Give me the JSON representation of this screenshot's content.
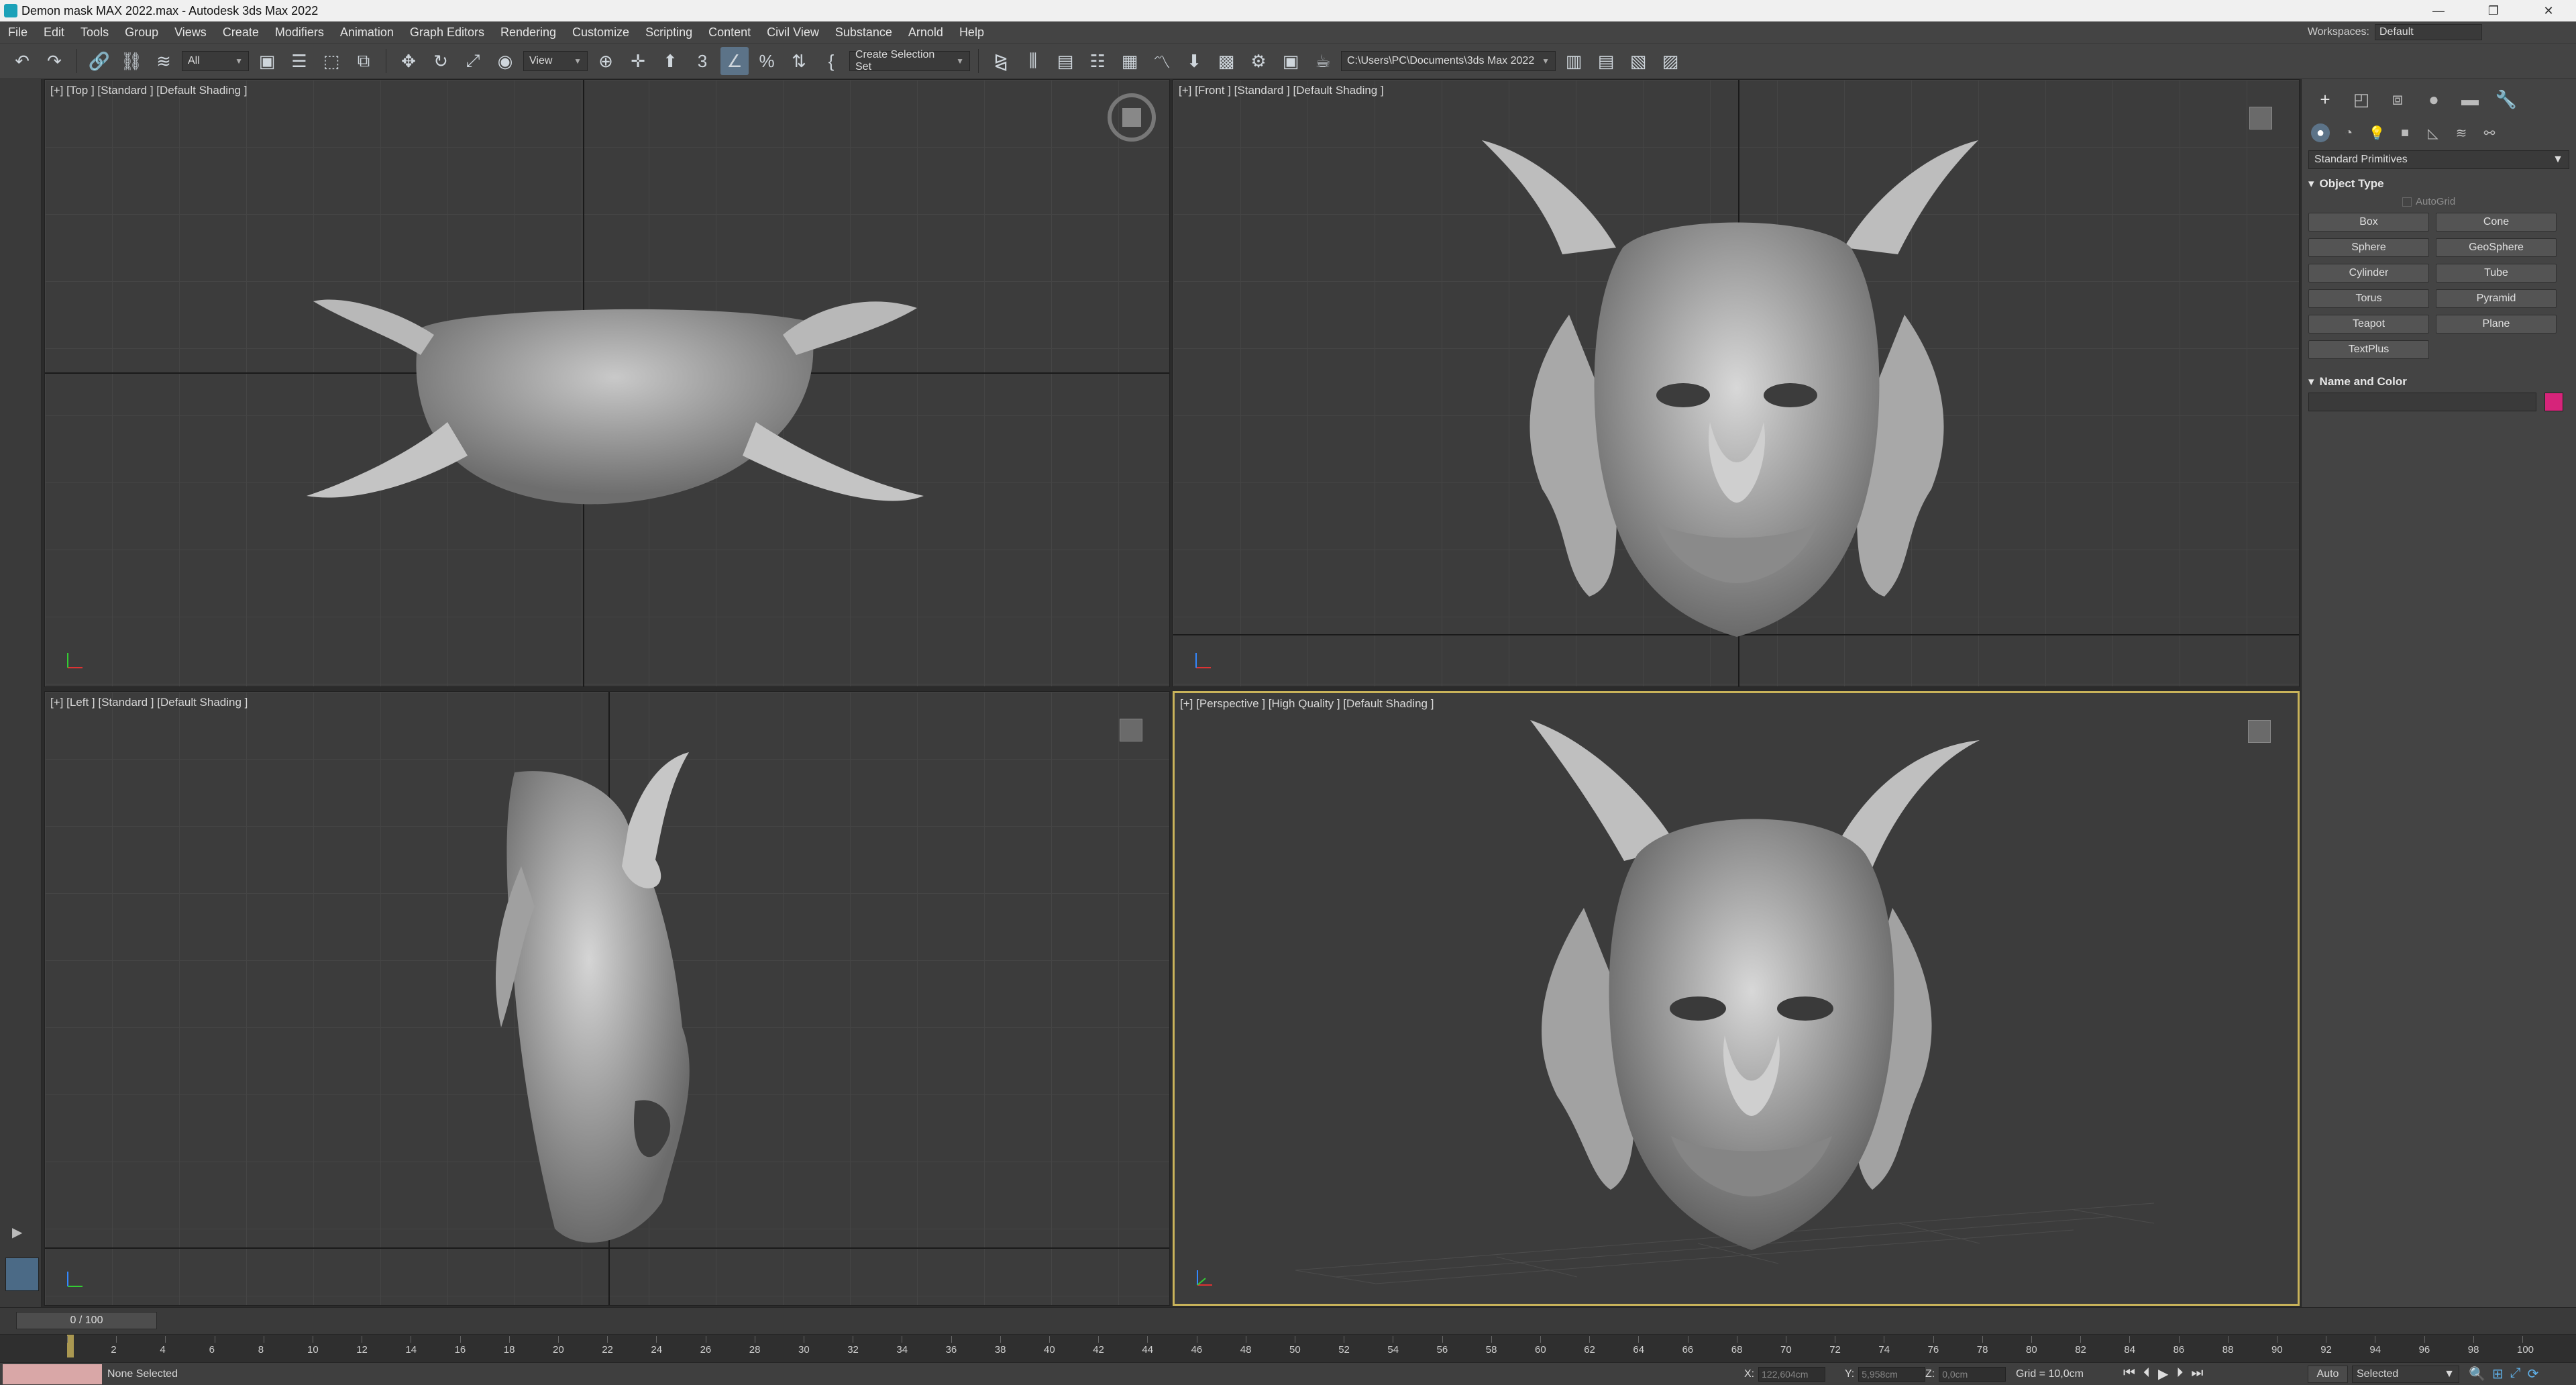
{
  "window": {
    "title": "Demon mask MAX 2022.max - Autodesk 3ds Max 2022",
    "minimize": "—",
    "restore": "❐",
    "close": "✕"
  },
  "menu": {
    "items": [
      "File",
      "Edit",
      "Tools",
      "Group",
      "Views",
      "Create",
      "Modifiers",
      "Animation",
      "Graph Editors",
      "Rendering",
      "Customize",
      "Scripting",
      "Content",
      "Civil View",
      "Substance",
      "Arnold",
      "Help"
    ],
    "workspaces_label": "Workspaces:",
    "workspace_value": "Default"
  },
  "toolbar": {
    "selection_filter": "All",
    "ref_coord": "View",
    "snap_label": "3",
    "named_selection": "Create Selection Set",
    "project_path": "C:\\Users\\PC\\Documents\\3ds Max 2022"
  },
  "viewports": {
    "top": {
      "label": "[+] [Top ] [Standard ] [Default Shading ]"
    },
    "front": {
      "label": "[+] [Front ] [Standard ] [Default Shading ]"
    },
    "left": {
      "label": "[+] [Left ] [Standard ] [Default Shading ]"
    },
    "perspective": {
      "label": "[+] [Perspective ] [High Quality ] [Default Shading ]"
    }
  },
  "command_panel": {
    "category": "Standard Primitives",
    "object_type_title": "Object Type",
    "autogrid": "AutoGrid",
    "primitives": [
      "Box",
      "Cone",
      "Sphere",
      "GeoSphere",
      "Cylinder",
      "Tube",
      "Torus",
      "Pyramid",
      "Teapot",
      "Plane",
      "TextPlus"
    ],
    "name_color_title": "Name and Color",
    "object_color": "#d6247a"
  },
  "timeline": {
    "frame": "0 / 100",
    "ticks": [
      "0",
      "2",
      "4",
      "6",
      "8",
      "10",
      "12",
      "14",
      "16",
      "18",
      "20",
      "22",
      "24",
      "26",
      "28",
      "30",
      "32",
      "34",
      "36",
      "38",
      "40",
      "42",
      "44",
      "46",
      "48",
      "50",
      "52",
      "54",
      "56",
      "58",
      "60",
      "62",
      "64",
      "66",
      "68",
      "70",
      "72",
      "74",
      "76",
      "78",
      "80",
      "82",
      "84",
      "86",
      "88",
      "90",
      "92",
      "94",
      "96",
      "98",
      "100"
    ]
  },
  "status": {
    "selection": "None Selected",
    "x_label": "X:",
    "x_value": "122,604cm",
    "y_label": "Y:",
    "y_value": "5,958cm",
    "z_label": "Z:",
    "z_value": "0,0cm",
    "grid": "Grid = 10,0cm",
    "auto_key": "Auto",
    "key_mode": "Selected"
  },
  "colors": {
    "accent": "#c9b35a",
    "active_tool": "#5c7388",
    "ui_bg": "#444444",
    "viewport_bg": "#3c3c3c"
  }
}
